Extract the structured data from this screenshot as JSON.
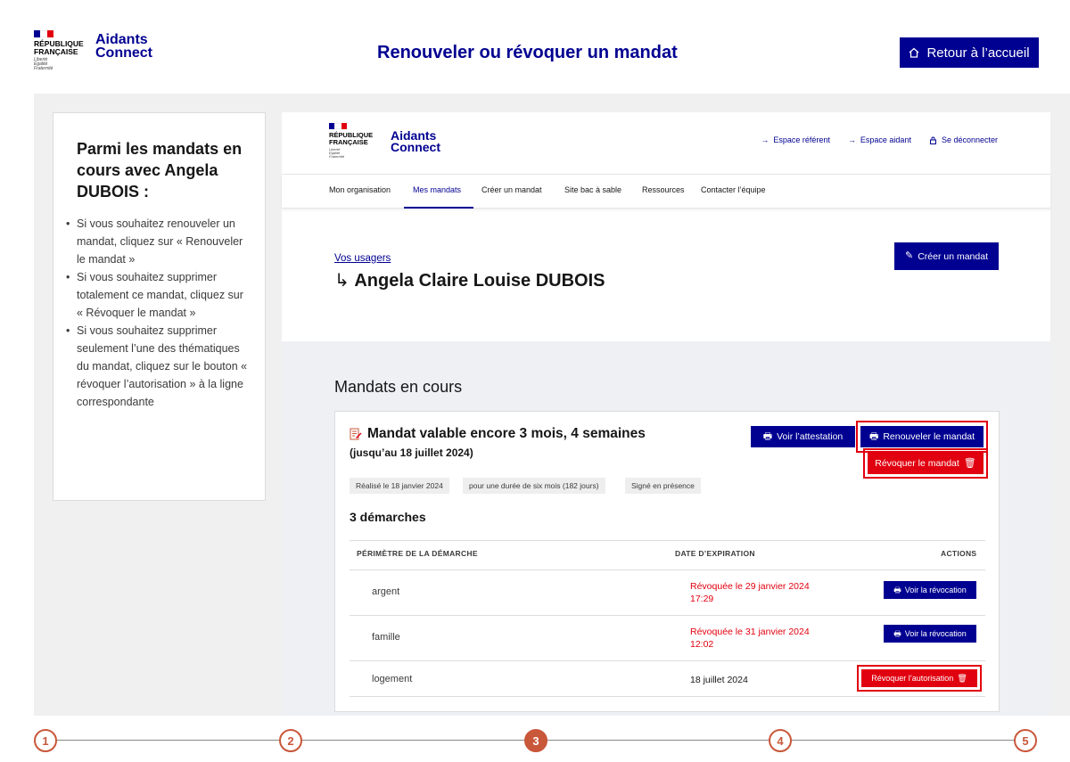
{
  "header": {
    "republique_line1": "RÉPUBLIQUE",
    "republique_line2": "FRANÇAISE",
    "motto": [
      "Liberté",
      "Égalité",
      "Fraternité"
    ],
    "app_name_line1": "Aidants",
    "app_name_line2": "Connect",
    "page_title": "Renouveler ou révoquer un mandat",
    "home_button": "Retour à l’accueil",
    "home_icon": "home-icon"
  },
  "instructions": {
    "title": "Parmi les mandats en cours avec Angela DUBOIS :",
    "items": [
      "Si vous souhaitez renouveler un mandat, cliquez sur « Renouveler le mandat »",
      "Si vous souhaitez supprimer totalement ce mandat, cliquez sur « Révoquer le mandat »",
      "Si vous souhaitez supprimer seulement l’une des thématiques du mandat, cliquez sur le bouton « révoquer l’autorisation » à la ligne correspondante"
    ]
  },
  "app": {
    "top_links": [
      "Espace référent",
      "Espace aidant",
      "Se déconnecter"
    ],
    "menu": [
      "Mon organisation",
      "Mes mandats",
      "Créer un mandat",
      "Site bac à sable",
      "Ressources",
      "Contacter l’équipe"
    ],
    "active_menu": "Mes mandats",
    "breadcrumb": "Vos usagers",
    "user_name": "Angela Claire Louise DUBOIS",
    "create_button": "Créer un mandat",
    "section_title": "Mandats en cours",
    "mandate": {
      "title": "Mandat valable encore 3 mois, 4 semaines",
      "subtitle": "(jusqu’au 18 juillet 2024)",
      "btn_attestation": "Voir l’attestation",
      "btn_renew": "Renouveler le mandat",
      "btn_revoke": "Révoquer le mandat",
      "tags": [
        "Réalisé le 18 janvier 2024",
        "pour une durée de six mois (182 jours)",
        "Signé en présence"
      ],
      "demarches_title": "3 démarches",
      "columns": [
        "PÉRIMÈTRE DE LA DÉMARCHE",
        "DATE D’EXPIRATION",
        "ACTIONS"
      ],
      "rows": [
        {
          "scope": "argent",
          "date_line1": "Révoquée le 29 janvier 2024",
          "date_line2": "17:29",
          "action": "Voir la révocation",
          "revoked": true
        },
        {
          "scope": "famille",
          "date_line1": "Révoquée le 31 janvier 2024",
          "date_line2": "12:02",
          "action": "Voir la révocation",
          "revoked": true
        },
        {
          "scope": "logement",
          "date_line1": "18 juillet 2024",
          "date_line2": "",
          "action": "Révoquer l’autorisation",
          "revoked": false
        }
      ]
    }
  },
  "steps": {
    "labels": [
      "1",
      "2",
      "3",
      "4",
      "5"
    ],
    "active": "3"
  },
  "colors": {
    "navy": "#000091",
    "red": "#e1000f",
    "step": "#c9573a"
  }
}
